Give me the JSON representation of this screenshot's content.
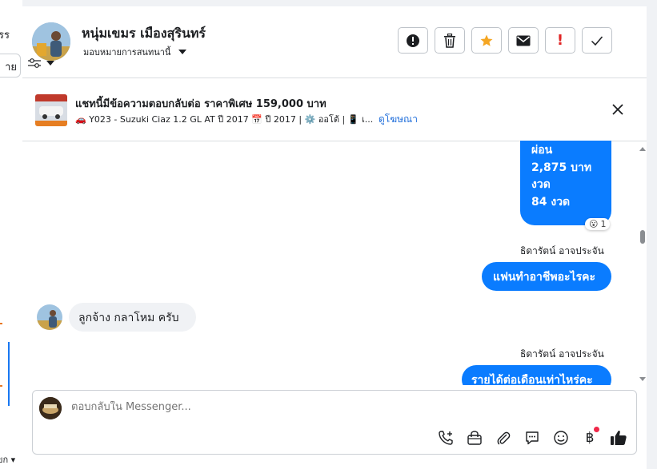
{
  "left_fragments": {
    "top": "รร",
    "pill": "าย",
    "bottom": "ขก ▾"
  },
  "header": {
    "contact_name": "หนุ่มเขมร เมืองสุรินทร์",
    "assign_label": "มอบหมายการสนทนานี้",
    "actions": [
      "alert-circle",
      "trash",
      "star",
      "mail",
      "flag-exclamation",
      "check"
    ]
  },
  "ad": {
    "title": "แชทนี้มีข้อความตอบกลับต่อ ราคาพิเศษ 159,000 บาท",
    "detail": "🚗 Y023 - Suzuki Ciaz 1.2 GL AT ปี 2017 📅 ปี 2017 | ⚙️ ออโต้ | 📱 เ...",
    "link": "ดูโฆษณา"
  },
  "messages": {
    "m1": {
      "line1": "ผ่อน",
      "line2": "2,875 บาท",
      "line3": "งวด",
      "line4": "84 งวด",
      "reaction_emoji": "😮",
      "reaction_count": "1"
    },
    "sender1": "ธิดารัตน์ อาจประจัน",
    "m2": "แฟนทำอาชีพอะไรคะ",
    "m3": "ลูกจ้าง กลาโหม ครับ",
    "sender2": "ธิดารัตน์ อาจประจัน",
    "m4": "รายได้ต่อเดือนเท่าไหร่คะ"
  },
  "composer": {
    "placeholder": "ตอบกลับใน Messenger...",
    "tools": [
      "phone-plus",
      "shopping-bag",
      "paperclip",
      "chat-dots",
      "smile",
      "baht",
      "thumbs-up"
    ],
    "baht_symbol": "฿"
  },
  "colors": {
    "accent": "#0a7cff",
    "star": "#f5a623",
    "alert": "#e02424"
  }
}
